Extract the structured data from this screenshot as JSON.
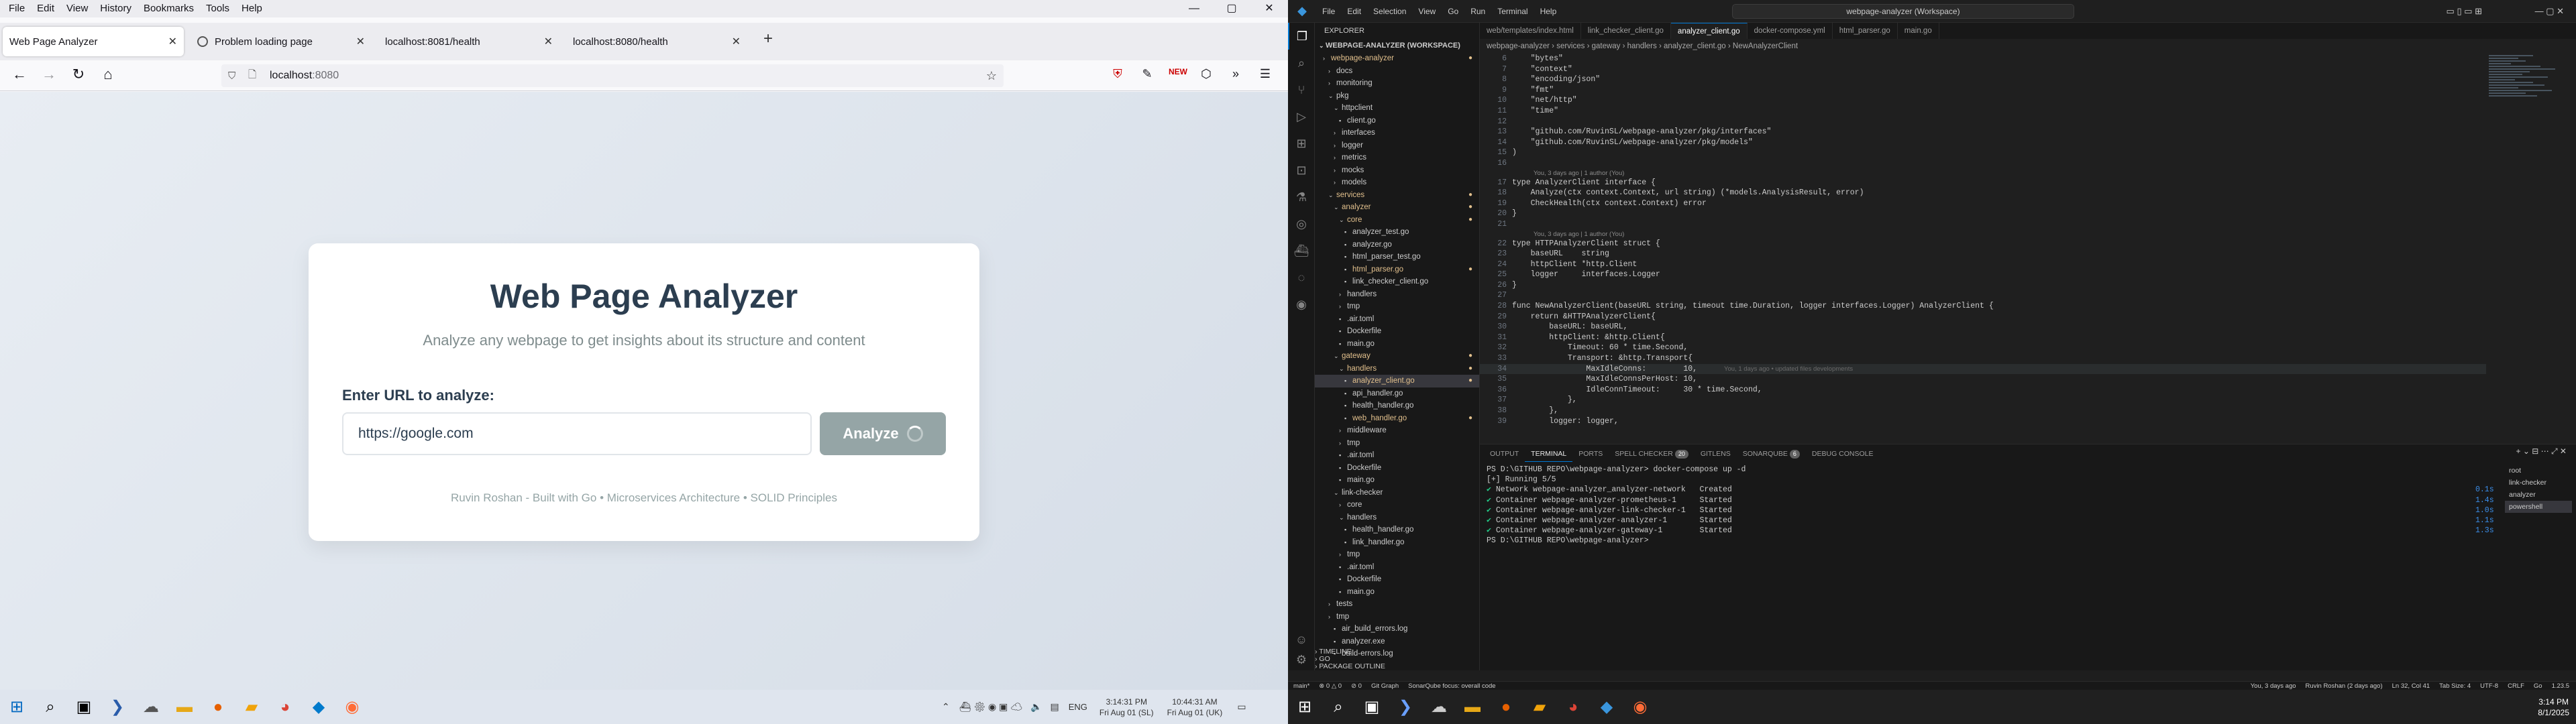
{
  "firefox": {
    "menu": [
      "File",
      "Edit",
      "View",
      "History",
      "Bookmarks",
      "Tools",
      "Help"
    ],
    "window_controls": [
      "—",
      "▢",
      "✕"
    ],
    "tabs": [
      {
        "title": "Web Page Analyzer",
        "active": true
      },
      {
        "title": "Problem loading page",
        "active": false
      },
      {
        "title": "localhost:8081/health",
        "active": false
      },
      {
        "title": "localhost:8080/health",
        "active": false
      }
    ],
    "new_tab": "+",
    "url_host": "localhost",
    "url_port": ":8080"
  },
  "app": {
    "title": "Web Page Analyzer",
    "subtitle": "Analyze any webpage to get insights about its structure and content",
    "input_label": "Enter URL to analyze:",
    "input_value": "https://google.com",
    "button_label": "Analyze",
    "footer": "Ruvin Roshan - Built with Go • Microservices Architecture • SOLID Principles"
  },
  "vscode": {
    "menu": [
      "File",
      "Edit",
      "Selection",
      "View",
      "Go",
      "Run",
      "Terminal",
      "Help"
    ],
    "search": "webpage-analyzer (Workspace)",
    "explorer_header": "EXPLORER",
    "workspace": "WEBPAGE-ANALYZER (WORKSPACE)",
    "tree": [
      {
        "i": 1,
        "t": "webpage-analyzer",
        "d": true,
        "c": "#e2c08d"
      },
      {
        "i": 2,
        "t": "docs",
        "d": true
      },
      {
        "i": 2,
        "t": "monitoring",
        "d": true
      },
      {
        "i": 2,
        "t": "pkg",
        "d": true,
        "open": true
      },
      {
        "i": 3,
        "t": "httpclient",
        "d": true,
        "open": true
      },
      {
        "i": 4,
        "t": "client.go"
      },
      {
        "i": 3,
        "t": "interfaces",
        "d": true
      },
      {
        "i": 3,
        "t": "logger",
        "d": true
      },
      {
        "i": 3,
        "t": "metrics",
        "d": true
      },
      {
        "i": 3,
        "t": "mocks",
        "d": true
      },
      {
        "i": 3,
        "t": "models",
        "d": true
      },
      {
        "i": 2,
        "t": "services",
        "d": true,
        "open": true,
        "c": "#e2c08d"
      },
      {
        "i": 3,
        "t": "analyzer",
        "d": true,
        "open": true,
        "c": "#e2c08d"
      },
      {
        "i": 4,
        "t": "core",
        "d": true,
        "open": true,
        "c": "#e2c08d"
      },
      {
        "i": 5,
        "t": "analyzer_test.go"
      },
      {
        "i": 5,
        "t": "analyzer.go"
      },
      {
        "i": 5,
        "t": "html_parser_test.go"
      },
      {
        "i": 5,
        "t": "html_parser.go",
        "c": "#e2c08d"
      },
      {
        "i": 5,
        "t": "link_checker_client.go"
      },
      {
        "i": 4,
        "t": "handlers",
        "d": true
      },
      {
        "i": 4,
        "t": "tmp",
        "d": true
      },
      {
        "i": 4,
        "t": ".air.toml"
      },
      {
        "i": 4,
        "t": "Dockerfile"
      },
      {
        "i": 4,
        "t": "main.go"
      },
      {
        "i": 3,
        "t": "gateway",
        "d": true,
        "open": true,
        "c": "#e2c08d"
      },
      {
        "i": 4,
        "t": "handlers",
        "d": true,
        "open": true,
        "c": "#e2c08d"
      },
      {
        "i": 5,
        "t": "analyzer_client.go",
        "c": "#e2c08d",
        "sel": true
      },
      {
        "i": 5,
        "t": "api_handler.go"
      },
      {
        "i": 5,
        "t": "health_handler.go"
      },
      {
        "i": 5,
        "t": "web_handler.go",
        "c": "#e2c08d"
      },
      {
        "i": 4,
        "t": "middleware",
        "d": true
      },
      {
        "i": 4,
        "t": "tmp",
        "d": true
      },
      {
        "i": 4,
        "t": ".air.toml"
      },
      {
        "i": 4,
        "t": "Dockerfile"
      },
      {
        "i": 4,
        "t": "main.go"
      },
      {
        "i": 3,
        "t": "link-checker",
        "d": true,
        "open": true
      },
      {
        "i": 4,
        "t": "core",
        "d": true
      },
      {
        "i": 4,
        "t": "handlers",
        "d": true,
        "open": true
      },
      {
        "i": 5,
        "t": "health_handler.go"
      },
      {
        "i": 5,
        "t": "link_handler.go"
      },
      {
        "i": 4,
        "t": "tmp",
        "d": true
      },
      {
        "i": 4,
        "t": ".air.toml"
      },
      {
        "i": 4,
        "t": "Dockerfile"
      },
      {
        "i": 4,
        "t": "main.go"
      },
      {
        "i": 2,
        "t": "tests",
        "d": true
      },
      {
        "i": 2,
        "t": "tmp",
        "d": true
      },
      {
        "i": 3,
        "t": "air_build_errors.log"
      },
      {
        "i": 3,
        "t": "analyzer.exe"
      },
      {
        "i": 3,
        "t": "build-errors.log"
      }
    ],
    "side_bottom": [
      "TIMELINE",
      "GO",
      "PACKAGE OUTLINE"
    ],
    "tabs": [
      {
        "t": "web/templates/index.html"
      },
      {
        "t": "link_checker_client.go"
      },
      {
        "t": "analyzer_client.go",
        "active": true
      },
      {
        "t": "docker-compose.yml"
      },
      {
        "t": "html_parser.go"
      },
      {
        "t": "main.go"
      }
    ],
    "breadcrumb": "webpage-analyzer › services › gateway › handlers › analyzer_client.go › NewAnalyzerClient",
    "code": [
      {
        "n": "6",
        "t": "    \"bytes\""
      },
      {
        "n": "7",
        "t": "    \"context\""
      },
      {
        "n": "8",
        "t": "    \"encoding/json\""
      },
      {
        "n": "9",
        "t": "    \"fmt\""
      },
      {
        "n": "10",
        "t": "    \"net/http\""
      },
      {
        "n": "11",
        "t": "    \"time\""
      },
      {
        "n": "12",
        "t": ""
      },
      {
        "n": "13",
        "t": "    \"github.com/RuvinSL/webpage-analyzer/pkg/interfaces\""
      },
      {
        "n": "14",
        "t": "    \"github.com/RuvinSL/webpage-analyzer/pkg/models\""
      },
      {
        "n": "15",
        "t": ")"
      },
      {
        "n": "16",
        "t": ""
      },
      {
        "lens": "You, 3 days ago | 1 author (You)"
      },
      {
        "n": "17",
        "t": "type AnalyzerClient interface {"
      },
      {
        "n": "18",
        "t": "    Analyze(ctx context.Context, url string) (*models.AnalysisResult, error)"
      },
      {
        "n": "19",
        "t": "    CheckHealth(ctx context.Context) error"
      },
      {
        "n": "20",
        "t": "}"
      },
      {
        "n": "21",
        "t": ""
      },
      {
        "lens": "You, 3 days ago | 1 author (You)"
      },
      {
        "n": "22",
        "t": "type HTTPAnalyzerClient struct {"
      },
      {
        "n": "23",
        "t": "    baseURL    string"
      },
      {
        "n": "24",
        "t": "    httpClient *http.Client"
      },
      {
        "n": "25",
        "t": "    logger     interfaces.Logger"
      },
      {
        "n": "26",
        "t": "}"
      },
      {
        "n": "27",
        "t": ""
      },
      {
        "n": "28",
        "t": "func NewAnalyzerClient(baseURL string, timeout time.Duration, logger interfaces.Logger) AnalyzerClient {"
      },
      {
        "n": "29",
        "t": "    return &HTTPAnalyzerClient{"
      },
      {
        "n": "30",
        "t": "        baseURL: baseURL,"
      },
      {
        "n": "31",
        "t": "        httpClient: &http.Client{"
      },
      {
        "n": "32",
        "t": "            Timeout: 60 * time.Second,"
      },
      {
        "n": "33",
        "t": "            Transport: &http.Transport{"
      },
      {
        "n": "34",
        "t": "                MaxIdleConns:        10,",
        "hl": true,
        "blame": "You, 1 days ago • updated files developments"
      },
      {
        "n": "35",
        "t": "                MaxIdleConnsPerHost: 10,"
      },
      {
        "n": "36",
        "t": "                IdleConnTimeout:     30 * time.Second,"
      },
      {
        "n": "37",
        "t": "            },"
      },
      {
        "n": "38",
        "t": "        },"
      },
      {
        "n": "39",
        "t": "        logger: logger,"
      }
    ],
    "panel_tabs": [
      {
        "t": "OUTPUT"
      },
      {
        "t": "TERMINAL",
        "on": true
      },
      {
        "t": "PORTS"
      },
      {
        "t": "SPELL CHECKER",
        "b": "20"
      },
      {
        "t": "GITLENS"
      },
      {
        "t": "SONARQUBE",
        "b": "6"
      },
      {
        "t": "DEBUG CONSOLE"
      }
    ],
    "terminal": [
      {
        "t": "PS D:\\GITHUB REPO\\webpage-analyzer> docker-compose up -d"
      },
      {
        "t": "[+] Running 5/5"
      },
      {
        "ok": "✔",
        "t": " Network webpage-analyzer_analyzer-network   Created",
        "tm": "0.1s"
      },
      {
        "ok": "✔",
        "t": " Container webpage-analyzer-prometheus-1     Started",
        "tm": "1.4s"
      },
      {
        "ok": "✔",
        "t": " Container webpage-analyzer-link-checker-1   Started",
        "tm": "1.0s"
      },
      {
        "ok": "✔",
        "t": " Container webpage-analyzer-analyzer-1       Started",
        "tm": "1.1s"
      },
      {
        "ok": "✔",
        "t": " Container webpage-analyzer-gateway-1        Started",
        "tm": "1.3s"
      },
      {
        "t": "PS D:\\GITHUB REPO\\webpage-analyzer> "
      }
    ],
    "terminal_list": [
      "root",
      "link-checker",
      "analyzer",
      "powershell"
    ],
    "status_left": [
      "main*",
      "⊗ 0 △ 0",
      "⊘ 0",
      "Git Graph",
      "SonarQube focus: overall code"
    ],
    "status_right": [
      "You, 3 days ago",
      "Ruvin Roshan (2 days ago)",
      "Ln 32, Col 41",
      "Tab Size: 4",
      "UTF-8",
      "CRLF",
      "Go",
      "1.23.5"
    ]
  },
  "taskbar_left": {
    "clock_time": "3:14:31 PM",
    "clock_date": "Fri Aug 01 (SL)",
    "clock2_time": "10:44:31 AM",
    "clock2_date": "Fri Aug 01 (UK)",
    "lang": "ENG"
  },
  "taskbar_right": {
    "time": "3:14 PM",
    "date": "8/1/2025"
  }
}
